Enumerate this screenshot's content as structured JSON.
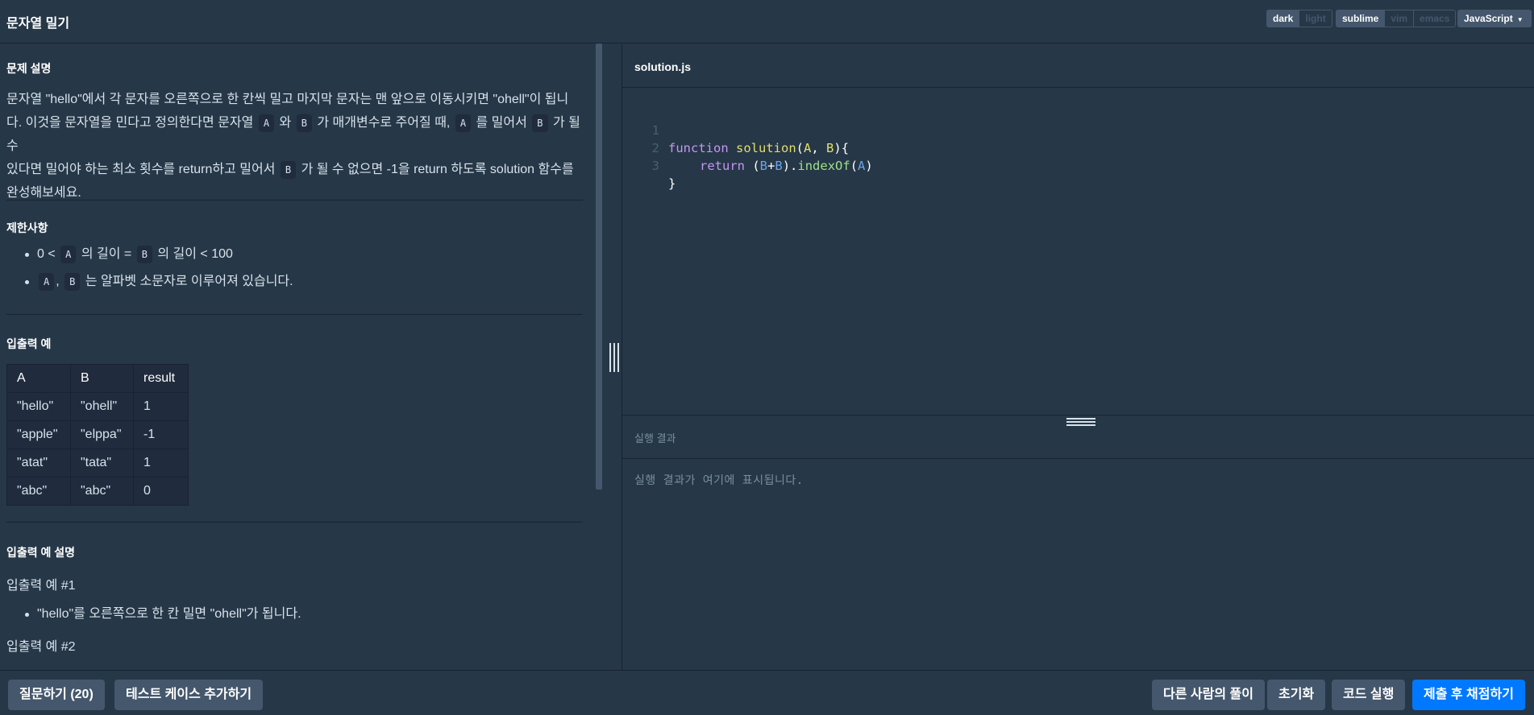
{
  "header": {
    "title": "문자열 밀기",
    "theme": [
      "dark",
      "light"
    ],
    "keymap": [
      "sublime",
      "vim",
      "emacs"
    ],
    "language": "JavaScript"
  },
  "problem": {
    "desc_heading": "문제 설명",
    "desc": {
      "p1": "문자열 \"hello\"에서 각 문자를 오른쪽으로 한 칸씩 밀고 마지막 문자는 맨 앞으로 이동시키면 \"ohell\"이 됩니",
      "p2a": "다. 이것을 문자열을 민다고 정의한다면 문자열",
      "A": "A",
      "B": "B",
      "wa": "와",
      "p2b": "가 매개변수로 주어질 때,",
      "p2c": "를 밀어서",
      "p2d": "가 될 수",
      "p3a": "있다면 밀어야 하는 최소 횟수를 return하고 밀어서",
      "p3b": "가 될 수 없으면 -1을 return 하도록 solution 함수를",
      "p4": "완성해보세요."
    },
    "constraints_heading": "제한사항",
    "constraints": {
      "c1a": "0 <",
      "c1b": "의 길이 =",
      "c1c": "의 길이 < 100",
      "comma": ",",
      "c2": "는 알파벳 소문자로 이루어져 있습니다."
    },
    "examples_heading": "입출력 예",
    "table": {
      "headers": [
        "A",
        "B",
        "result"
      ],
      "rows": [
        [
          "\"hello\"",
          "\"ohell\"",
          "1"
        ],
        [
          "\"apple\"",
          "\"elppa\"",
          "-1"
        ],
        [
          "\"atat\"",
          "\"tata\"",
          "1"
        ],
        [
          "\"abc\"",
          "\"abc\"",
          "0"
        ]
      ]
    },
    "explain_heading": "입출력 예 설명",
    "ex1_title": "입출력 예 #1",
    "ex1_bullet": "\"hello\"를 오른쪽으로 한 칸 밀면 \"ohell\"가 됩니다.",
    "ex2_title": "입출력 예 #2"
  },
  "editor": {
    "filename": "solution.js",
    "lines": [
      "1",
      "2",
      "3"
    ],
    "code": {
      "l1_kw": "function",
      "l1_fn": "solution",
      "l1_open": "(",
      "l1_a": "A",
      "l1_comma": ", ",
      "l1_b": "B",
      "l1_close": "){",
      "l2_kw": "return",
      "l2_p1": " (",
      "l2_b1": "B",
      "l2_plus": "+",
      "l2_b2": "B",
      "l2_p2": ").",
      "l2_meth": "indexOf",
      "l2_p3": "(",
      "l2_a": "A",
      "l2_p4": ")",
      "l3": "}"
    }
  },
  "result": {
    "heading": "실행 결과",
    "placeholder": "실행 결과가 여기에 표시됩니다."
  },
  "footer": {
    "ask": "질문하기 (20)",
    "add_tests": "테스트 케이스 추가하기",
    "others": "다른 사람의 풀이",
    "reset": "초기화",
    "run": "코드 실행",
    "submit": "제출 후 채점하기"
  }
}
